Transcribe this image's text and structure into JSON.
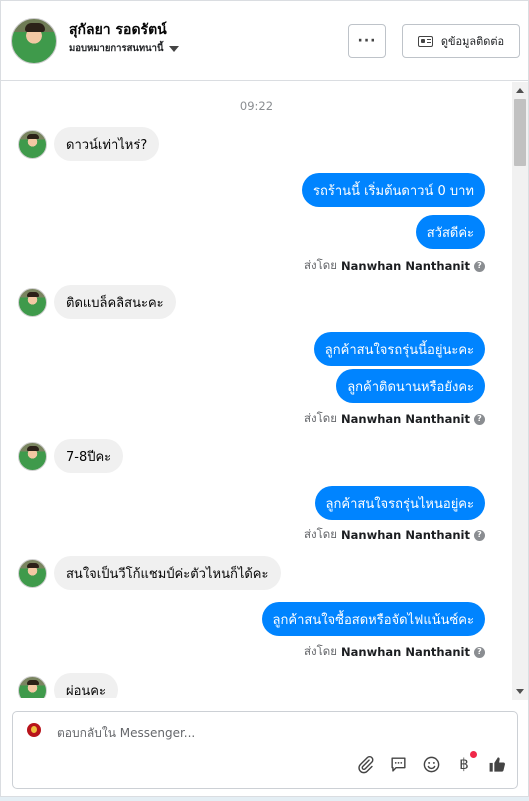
{
  "header": {
    "contact_name": "สุกัลยา รอดรัตน์",
    "assign_label": "มอบหมายการสนทนานี้",
    "more_label": "···",
    "contact_info_label": "ดูข้อมูลติดต่อ"
  },
  "conversation": {
    "timestamp": "09:22",
    "sent_by_prefix": "ส่งโดย",
    "sender_name": "Nanwhan Nanthanit",
    "help_glyph": "?",
    "messages": [
      {
        "direction": "in",
        "text": "ดาวน์เท่าไหร่?"
      },
      {
        "direction": "out",
        "text": "รถร้านนี้ เริ่มต้นดาวน์ 0 บาท"
      },
      {
        "direction": "out",
        "text": "สวัสดีค่ะ"
      },
      {
        "direction": "in",
        "text": "ติดแบล็คลิสนะคะ"
      },
      {
        "direction": "out",
        "text": "ลูกค้าสนใจรถรุ่นนี้อยู่นะคะ"
      },
      {
        "direction": "out",
        "text": "ลูกค้าติดนานหรือยังคะ"
      },
      {
        "direction": "in",
        "text": "7-8ปีคะ"
      },
      {
        "direction": "out",
        "text": "ลูกค้าสนใจรถรุ่นไหนอยู่คะ"
      },
      {
        "direction": "in",
        "text": "สนใจเป็นวีโก้แชมป์ค่ะตัวไหนก็ได้คะ"
      },
      {
        "direction": "out",
        "text": "ลูกค้าสนใจซื้อสดหรือจัดไฟแน้นซ์คะ"
      },
      {
        "direction": "in",
        "text": "ผ่อนคะ"
      }
    ]
  },
  "composer": {
    "placeholder": "ตอบกลับใน Messenger...",
    "baht_glyph": "฿",
    "icons": [
      "attachment-icon",
      "saved-reply-icon",
      "emoji-icon",
      "payment-icon",
      "like-icon"
    ]
  },
  "colors": {
    "outgoing_bubble": "#0084ff",
    "incoming_bubble": "#f0f0f0",
    "notification_dot": "#f02849"
  }
}
